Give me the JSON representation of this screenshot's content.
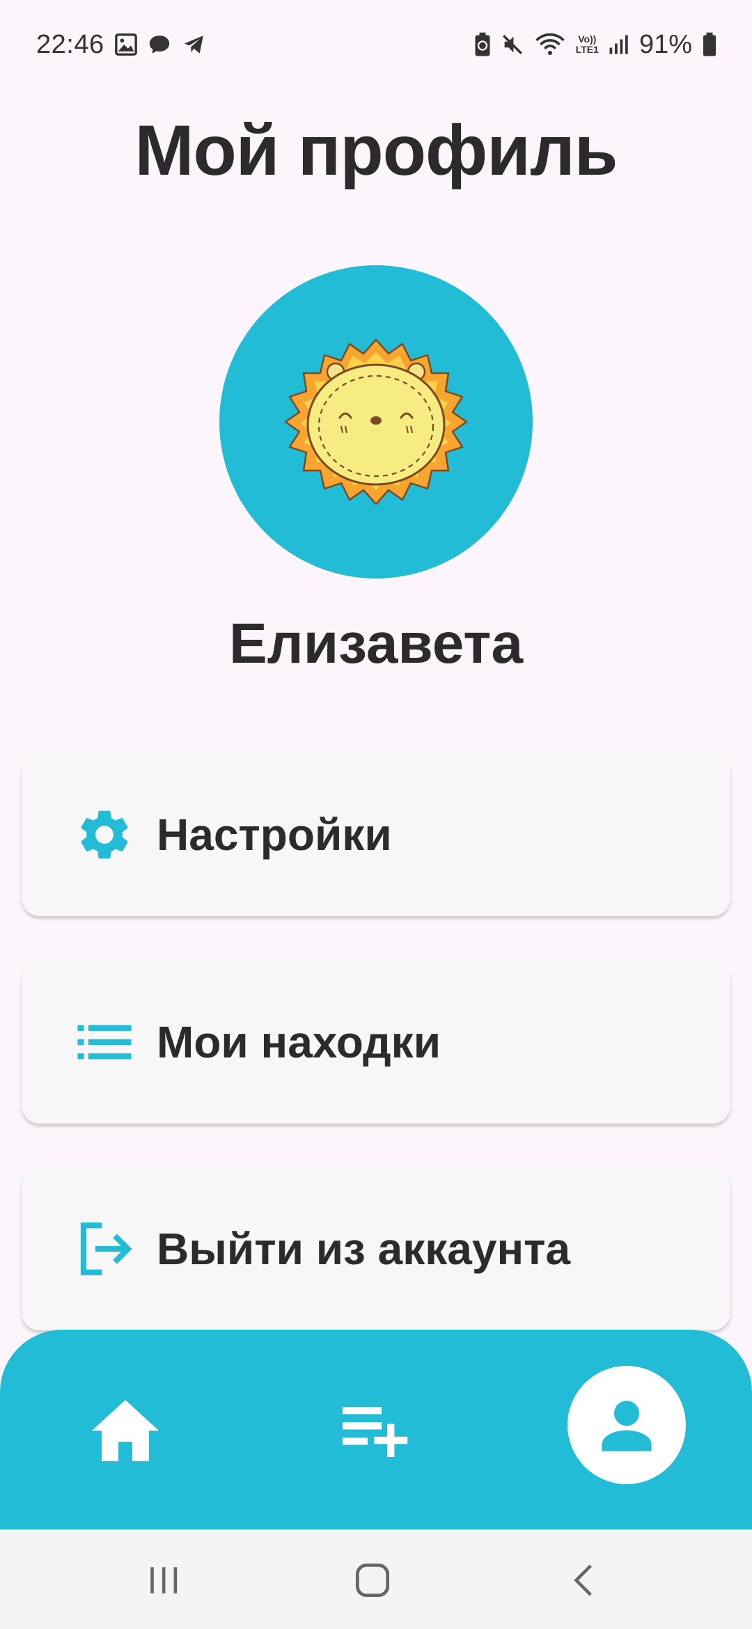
{
  "status_bar": {
    "time": "22:46",
    "left_icons": [
      "image-icon",
      "chat-bubble-icon",
      "telegram-icon"
    ],
    "right_icons": [
      "battery-saver-icon",
      "mute-icon",
      "wifi-icon",
      "volte-icon",
      "signal-icon",
      "battery-icon"
    ],
    "volte_line1": "Vo))",
    "volte_line2": "LTE1",
    "battery": "91%"
  },
  "header": {
    "title": "Мой профиль"
  },
  "profile": {
    "avatar": "sun-lion-avatar",
    "name": "Елизавета"
  },
  "menu": [
    {
      "label": "Настройки",
      "icon": "gear-icon"
    },
    {
      "label": "Мои находки",
      "icon": "list-icon"
    },
    {
      "label": "Выйти из аккаунта",
      "icon": "logout-icon"
    }
  ],
  "bottom_nav": {
    "items": [
      {
        "icon": "home-icon"
      },
      {
        "icon": "playlist-add-icon"
      },
      {
        "icon": "profile-icon",
        "active": true
      }
    ]
  },
  "system_nav": [
    "recent-apps-icon",
    "home-icon",
    "back-icon"
  ],
  "colors": {
    "accent": "#22bcd6",
    "background": "#fcf6fc",
    "card": "#f7f7f7",
    "text": "#2b2b2b"
  }
}
